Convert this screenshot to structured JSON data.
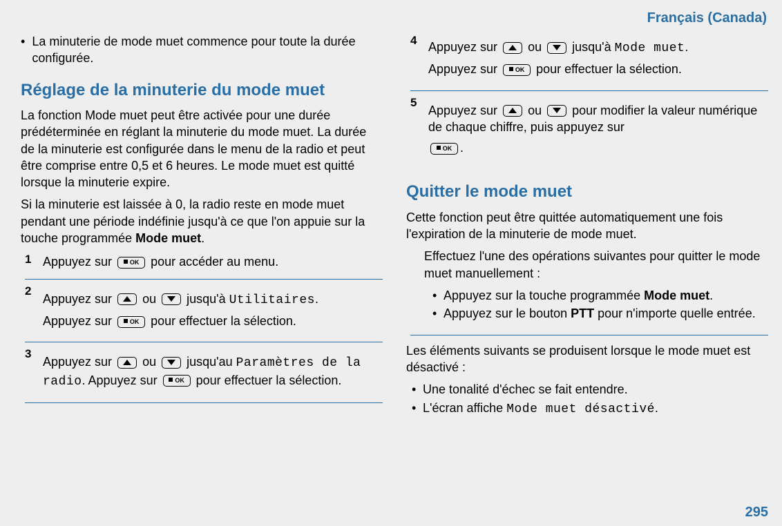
{
  "header": {
    "language": "Français (Canada)"
  },
  "page_number": "295",
  "left": {
    "top_bullet": "La minuterie de mode muet commence pour toute la durée configurée.",
    "section_title": "Réglage de la minuterie du mode muet",
    "para1": "La fonction Mode muet peut être activée pour une durée prédéterminée en réglant la minuterie du mode muet. La durée de la minuterie est configurée dans le menu de la radio et peut être comprise entre 0,5 et 6 heures. Le mode muet est quitté lorsque la minuterie expire.",
    "para2_pre": "Si la minuterie est laissée à 0, la radio reste en mode muet pendant une période indéfinie jusqu'à ce que l'on appuie sur la touche programmée ",
    "para2_bold": "Mode muet",
    "para2_post": ".",
    "steps": {
      "s1_pre": "Appuyez sur ",
      "s1_post": " pour accéder au menu.",
      "s2_l1_a": "Appuyez sur ",
      "s2_l1_b": " ou ",
      "s2_l1_c": " jusqu'à ",
      "s2_l1_util": "Utilitaires",
      "s2_l1_d": ".",
      "s2_l2_a": "Appuyez sur ",
      "s2_l2_b": " pour effectuer la sélection.",
      "s3_l1_a": "Appuyez sur ",
      "s3_l1_b": " ou ",
      "s3_l1_c": " jusqu'au ",
      "s3_l1_param": "Paramètres de la radio",
      "s3_l1_d": ". Appuyez sur ",
      "s3_l1_e": " pour effectuer la sélection."
    }
  },
  "right": {
    "steps": {
      "s4_l1_a": "Appuyez sur ",
      "s4_l1_b": " ou ",
      "s4_l1_c": " jusqu'à ",
      "s4_l1_mm": "Mode muet",
      "s4_l1_d": ".",
      "s4_l2_a": "Appuyez sur ",
      "s4_l2_b": " pour effectuer la sélection.",
      "s5_l1_a": "Appuyez sur ",
      "s5_l1_b": " ou ",
      "s5_l1_c": " pour modifier la valeur numérique de chaque chiffre, puis appuyez sur ",
      "s5_l1_d": "."
    },
    "section_title": "Quitter le mode muet",
    "para1": "Cette fonction peut être quittée automatiquement une fois l'expiration de la minuterie de mode muet.",
    "box_intro": "Effectuez l'une des opérations suivantes pour quitter le mode muet manuellement :",
    "box_b1_a": "Appuyez sur la touche programmée ",
    "box_b1_bold": "Mode muet",
    "box_b1_b": ".",
    "box_b2_a": "Appuyez sur le bouton ",
    "box_b2_bold": "PTT",
    "box_b2_b": " pour n'importe quelle entrée.",
    "after1": "Les éléments suivants se produisent lorsque le mode muet est désactivé :",
    "after_b1": "Une tonalité d'échec se fait entendre.",
    "after_b2_a": "L'écran affiche ",
    "after_b2_mono": "Mode muet désactivé",
    "after_b2_b": "."
  },
  "icons": {
    "ok_text": "OK"
  }
}
